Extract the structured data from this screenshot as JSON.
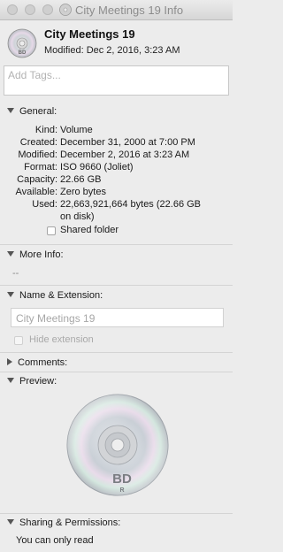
{
  "window": {
    "title": "City Meetings 19 Info"
  },
  "header": {
    "name": "City Meetings 19",
    "modified": "Modified: Dec 2, 2016, 3:23 AM",
    "icon": "bluray-disc-icon"
  },
  "tags": {
    "placeholder": "Add Tags..."
  },
  "general": {
    "title": "General:",
    "rows": [
      {
        "label": "Kind:",
        "value": "Volume"
      },
      {
        "label": "Created:",
        "value": "December 31, 2000 at 7:00 PM"
      },
      {
        "label": "Modified:",
        "value": "December 2, 2016 at 3:23 AM"
      },
      {
        "label": "Format:",
        "value": "ISO 9660 (Joliet)"
      },
      {
        "label": "Capacity:",
        "value": "22.66 GB"
      },
      {
        "label": "Available:",
        "value": "Zero bytes"
      },
      {
        "label": "Used:",
        "value": "22,663,921,664 bytes (22.66 GB",
        "value2": "on disk)"
      }
    ],
    "shared_folder": "Shared folder",
    "shared_checked": false
  },
  "more_info": {
    "title": "More Info:",
    "value": "--"
  },
  "name_ext": {
    "title": "Name & Extension:",
    "field_value": "City Meetings 19",
    "hide_extension": "Hide extension",
    "hide_checked": false
  },
  "comments": {
    "title": "Comments:"
  },
  "preview": {
    "title": "Preview:",
    "disc_label": "BD",
    "disc_sublabel": "R"
  },
  "sharing": {
    "title": "Sharing & Permissions:",
    "status": "You can only read"
  }
}
